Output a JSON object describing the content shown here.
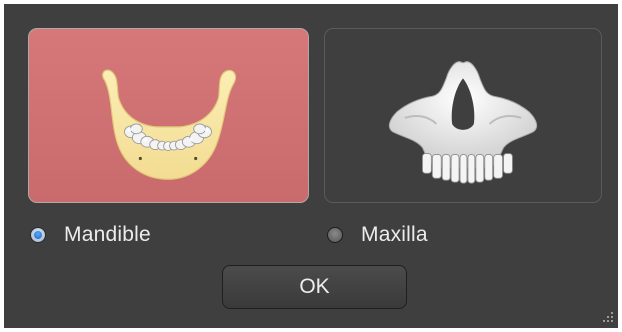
{
  "dialog": {
    "options": [
      {
        "id": "mandible",
        "label": "Mandible",
        "selected": true
      },
      {
        "id": "maxilla",
        "label": "Maxilla",
        "selected": false
      }
    ],
    "ok_label": "OK"
  },
  "colors": {
    "dialog_bg": "#3f3f3f",
    "selected_card_bg": "#ce6e70",
    "bone": "#f6e3a0",
    "teeth": "#f2f2f2",
    "radio_accent": "#2f7fe0"
  },
  "icons": {
    "mandible": "mandible-jaw-icon",
    "maxilla": "maxilla-skull-icon",
    "grip": "size-grip-icon"
  }
}
